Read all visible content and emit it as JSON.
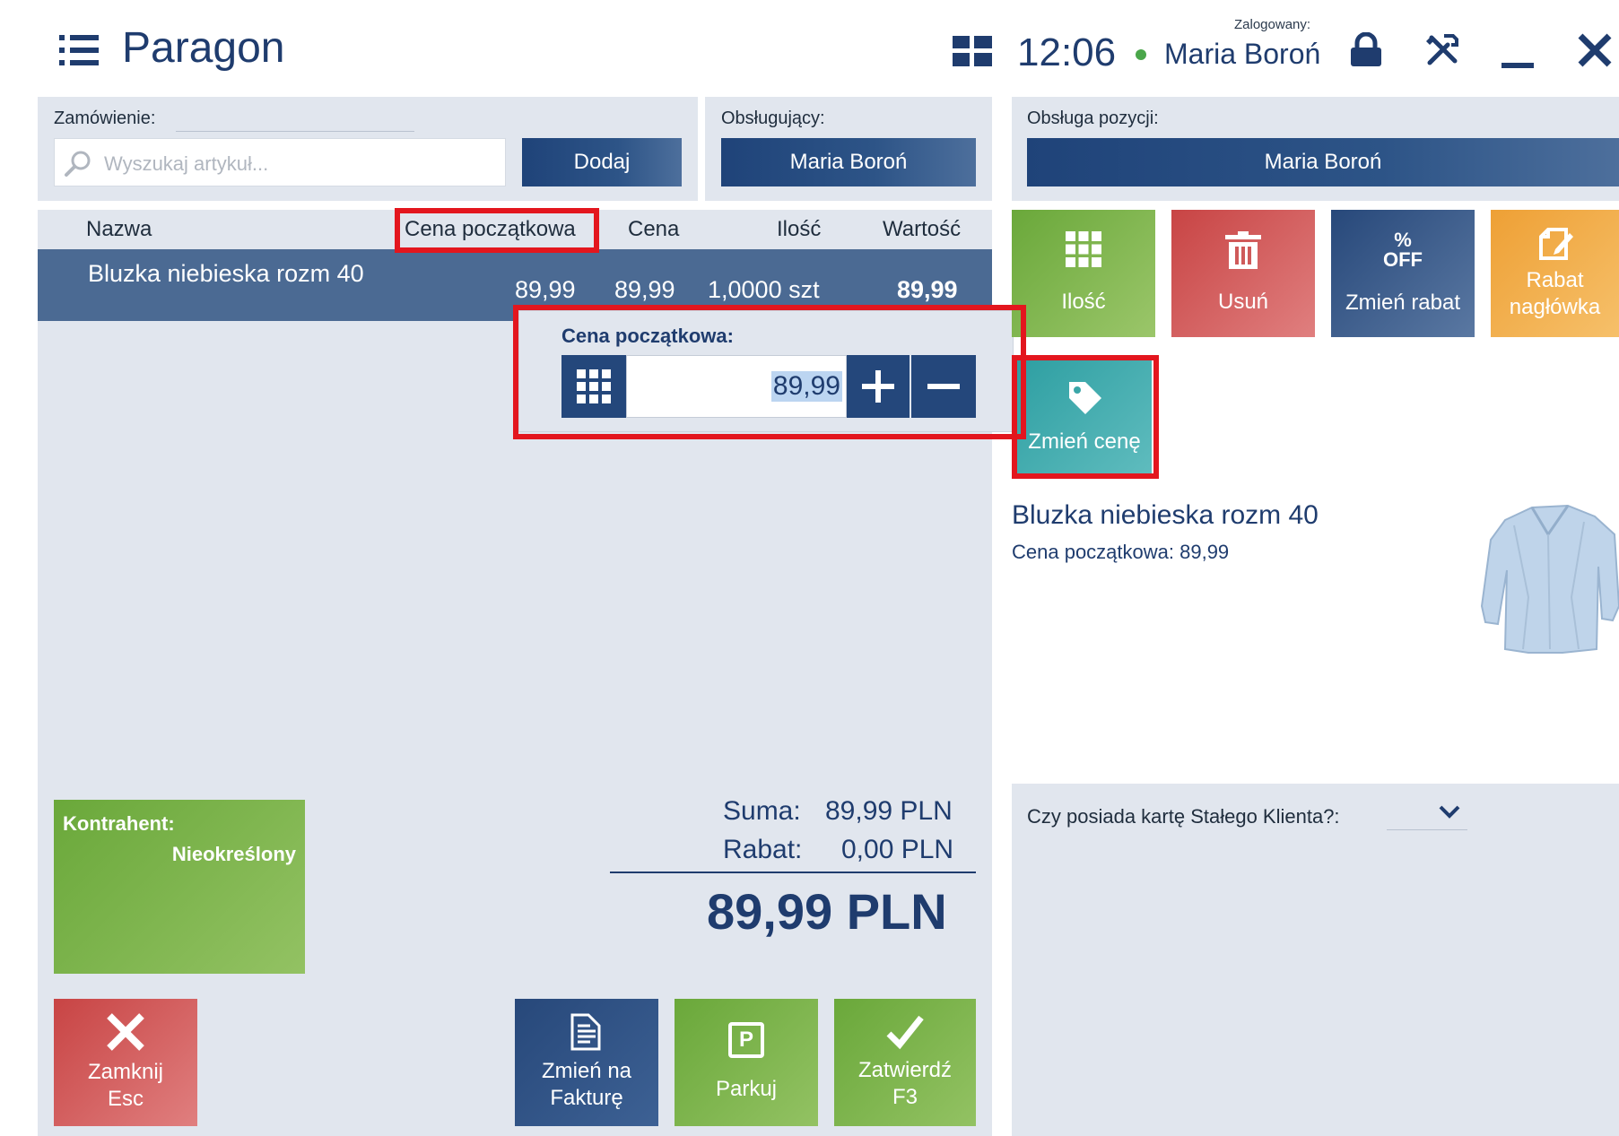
{
  "header": {
    "title": "Paragon",
    "time": "12:06",
    "logged_label": "Zalogowany:",
    "user": "Maria Boroń",
    "icons": [
      "menu-list-icon",
      "grid-icon",
      "lock-icon",
      "tools-icon",
      "minimize-icon",
      "close-icon"
    ]
  },
  "order": {
    "label": "Zamówienie:",
    "search_placeholder": "Wyszukaj artykuł...",
    "add_button": "Dodaj"
  },
  "cashier": {
    "label": "Obsługujący:",
    "value": "Maria Boroń"
  },
  "item_service": {
    "label": "Obsługa pozycji:",
    "value": "Maria Boroń"
  },
  "table": {
    "columns": [
      "Nazwa",
      "Cena początkowa",
      "Cena",
      "Ilość",
      "Wartość"
    ],
    "rows": [
      {
        "name": "Bluzka niebieska rozm 40",
        "initial_price": "89,99",
        "price": "89,99",
        "qty": "1,0000 szt",
        "value": "89,99"
      }
    ]
  },
  "price_popup": {
    "label": "Cena początkowa:",
    "value": "89,99"
  },
  "actions": {
    "qty": "Ilość",
    "delete": "Usuń",
    "discount_icon_text_top": "%",
    "discount_icon_text_bottom": "OFF",
    "discount": "Zmień rabat",
    "header_discount_line1": "Rabat",
    "header_discount_line2": "nagłówka",
    "change_price": "Zmień cenę"
  },
  "item_info": {
    "name": "Bluzka niebieska rozm 40",
    "initial_price_text": "Cena początkowa: 89,99"
  },
  "customer": {
    "label": "Kontrahent:",
    "value": "Nieokreślony"
  },
  "totals": {
    "sum_label": "Suma:",
    "sum_value": "89,99 PLN",
    "discount_label": "Rabat:",
    "discount_value": "0,00 PLN",
    "total": "89,99 PLN"
  },
  "loyalty": {
    "question": "Czy posiada kartę Stałego Klienta?:"
  },
  "bottom_buttons": {
    "close_line1": "Zamknij",
    "close_line2": "Esc",
    "invoice_line1": "Zmień na",
    "invoice_line2": "Fakturę",
    "park": "Parkuj",
    "park_icon_letter": "P",
    "confirm_line1": "Zatwierdź",
    "confirm_line2": "F3"
  },
  "colors": {
    "navy": "#24477b",
    "green": "#7fb84f",
    "red": "#cd4b4b",
    "orange": "#f0a93e",
    "teal": "#3aa6a8",
    "highlight_red": "#e3161e",
    "panel": "#e1e6ee"
  }
}
